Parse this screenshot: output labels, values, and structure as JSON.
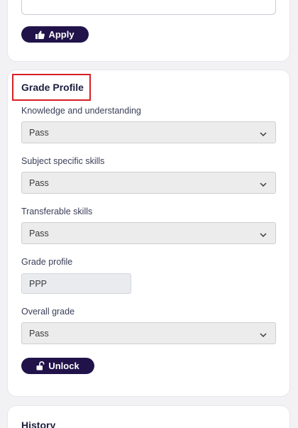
{
  "top_card": {
    "apply_label": "Apply"
  },
  "grade_profile_card": {
    "title": "Grade Profile",
    "fields": [
      {
        "label": "Knowledge and understanding",
        "value": "Pass"
      },
      {
        "label": "Subject specific skills",
        "value": "Pass"
      },
      {
        "label": "Transferable skills",
        "value": "Pass"
      }
    ],
    "grade_profile": {
      "label": "Grade profile",
      "value": "PPP"
    },
    "overall_grade": {
      "label": "Overall grade",
      "value": "Pass"
    },
    "unlock_label": "Unlock"
  },
  "history_card": {
    "title": "History"
  },
  "colors": {
    "primary": "#21134a",
    "highlight_border": "#d61f26"
  },
  "icons": {
    "apply": "thumbs-up-icon",
    "unlock": "unlock-icon",
    "select": "chevron-down-icon"
  }
}
